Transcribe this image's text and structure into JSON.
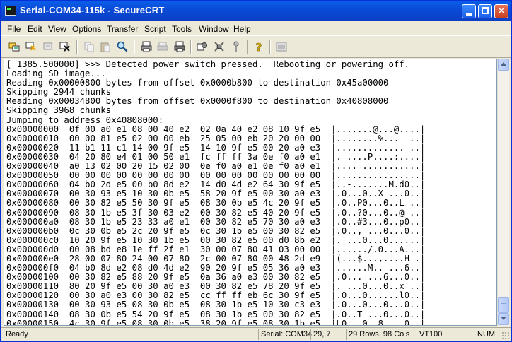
{
  "window": {
    "title": "Serial-COM34-115k - SecureCRT"
  },
  "menu": [
    "File",
    "Edit",
    "View",
    "Options",
    "Transfer",
    "Script",
    "Tools",
    "Window",
    "Help"
  ],
  "toolbar_icons": [
    "connect-icon",
    "quick-connect-icon",
    "connect-in-tab-icon",
    "disconnect-icon",
    "copy-icon",
    "paste-icon",
    "find-icon",
    "print-icon",
    "print-selection-icon",
    "print-screen-icon",
    "session-options-icon",
    "global-options-icon",
    "keymap-icon",
    "help-icon",
    "sftp-icon"
  ],
  "terminal_lines": [
    "[ 1385.500000] >>> Detected power switch pressed.  Rebooting or powering off.",
    "Loading SD image...",
    "Reading 0x00000800 bytes from offset 0x0000b800 to destination 0x45a00000",
    "Skipping 2944 chunks",
    "Reading 0x00034800 bytes from offset 0x0000f800 to destination 0x40808000",
    "Skipping 3968 chunks",
    "Jumping to address 0x40808000:",
    "0x00000000  0f 00 a0 e1 08 00 40 e2  02 0a 40 e2 08 10 9f e5  |.......@...@....|",
    "0x00000010  00 00 81 e5 02 00 00 eb  25 05 00 eb 20 20 00 00  |........%...  ..|",
    "0x00000020  11 b1 11 c1 14 00 9f e5  14 10 9f e5 00 20 a0 e3  |............. ..|",
    "0x00000030  04 20 80 e4 01 00 50 e1  fc ff ff 3a 0e f0 a0 e1  |. ....P....:....|",
    "0x00000040  a0 13 02 00 20 15 02 00  0e f0 a0 e1 0e f0 a0 e1  |.... ...........|",
    "0x00000050  00 00 00 00 00 00 00 00  00 00 00 00 00 00 00 00  |................|",
    "0x00000060  04 b0 2d e5 00 b0 8d e2  14 d0 4d e2 64 30 9f e5  |..-.......M.d0..|",
    "0x00000070  00 30 93 e5 10 30 0b e5  58 20 9f e5 00 30 a0 e3  |.0...0..X ...0..|",
    "0x00000080  00 30 82 e5 50 30 9f e5  08 30 0b e5 4c 20 9f e5  |.0..P0...0..L ..|",
    "0x00000090  08 30 1b e5 3f 30 03 e2  00 30 82 e5 40 20 9f e5  |.0..?0...0..@ ..|",
    "0x000000a0  08 30 1b e5 23 33 a0 e1  00 30 82 e5 70 30 a0 e3  |.0..#3...0..p0..|",
    "0x000000b0  0c 30 0b e5 2c 20 9f e5  0c 30 1b e5 00 30 82 e5  |.0.., ...0...0..|",
    "0x000000c0  10 20 9f e5 10 30 1b e5  00 30 82 e5 00 d0 8b e2  |. ...0...0......|",
    "0x000000d0  00 08 bd e8 1e ff 2f e1  30 00 07 80 41 03 00 00  |....../.0...A...|",
    "0x000000e0  28 00 07 80 24 00 07 80  2c 00 07 80 00 48 2d e9  |(...$...,....H-.|",
    "0x000000f0  04 b0 8d e2 08 d0 4d e2  90 20 9f e5 05 36 a0 e3  |......M.. ...6..|",
    "0x00000100  00 30 82 e5 88 20 9f e5  0a 36 a0 e3 00 30 82 e5  |.0... ...6...0..|",
    "0x00000110  80 20 9f e5 00 30 a0 e3  00 30 82 e5 78 20 9f e5  |. ...0...0..x ..|",
    "0x00000120  00 30 a0 e3 00 30 82 e5  cc ff ff eb 6c 30 9f e5  |.0...0......l0..|",
    "0x00000130  00 30 93 e5 08 30 0b e5  08 30 1b e5 10 30 c3 e3  |.0...0...0...0..|",
    "0x00000140  08 30 0b e5 54 20 9f e5  08 30 1b e5 00 30 82 e5  |.0..T ...0...0..|",
    "0x00000150  4c 30 9f e5 08 30 0b e5  38 20 9f e5 08 30 1b e5  |L0...0..8 ...0..|"
  ],
  "status": {
    "ready": "Ready",
    "connection": "Serial: COM34",
    "cursor": "29,  7",
    "size": "29 Rows, 98 Cols",
    "emulation": "VT100",
    "caps": "",
    "num": "NUM"
  },
  "scrollbar": {
    "position_fraction": 1.0
  }
}
